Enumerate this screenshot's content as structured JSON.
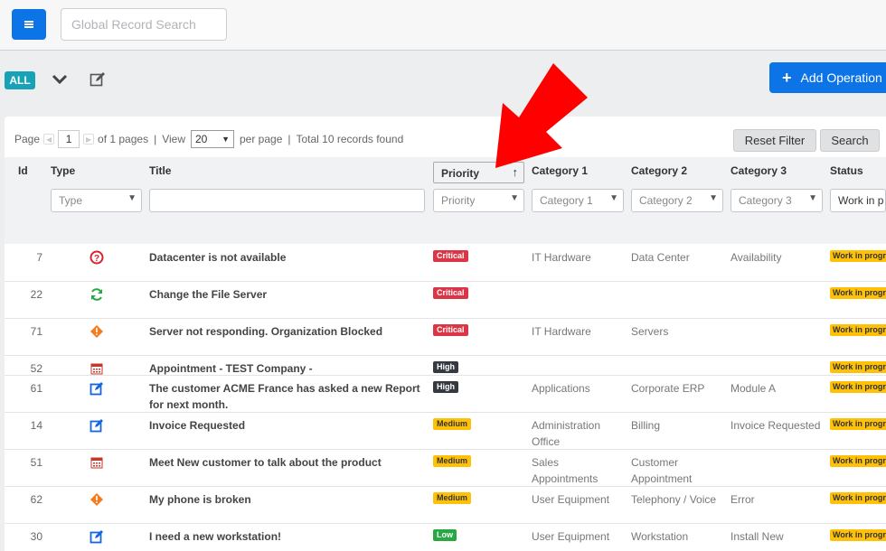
{
  "topbar": {
    "search_placeholder": "Global Record Search"
  },
  "toolbar": {
    "all_label": "ALL",
    "add_operation_label": "Add Operation"
  },
  "pager": {
    "page_label": "Page",
    "page_value": "1",
    "of_pages": "of 1 pages",
    "sep1": "|",
    "view_label": "View",
    "per_page_value": "20",
    "per_page_label": "per page",
    "sep2": "|",
    "total": "Total 10 records found"
  },
  "buttons": {
    "reset_filter": "Reset Filter",
    "search": "Search"
  },
  "columns": {
    "id": "Id",
    "type": "Type",
    "title": "Title",
    "priority": "Priority",
    "category1": "Category 1",
    "category2": "Category 2",
    "category3": "Category 3",
    "status": "Status"
  },
  "filters": {
    "type": "Type",
    "title": "",
    "priority": "Priority",
    "category1": "Category 1",
    "category2": "Category 2",
    "category3": "Category 3",
    "status": "Work in p"
  },
  "rows": [
    {
      "id": "7",
      "type_icon": "question-icon",
      "title": "Datacenter is not available",
      "priority": "Critical",
      "cat1": "IT Hardware",
      "cat2": "Data Center",
      "cat3": "Availability",
      "status": "Work in progress"
    },
    {
      "id": "22",
      "type_icon": "refresh-icon",
      "title": "Change the File Server",
      "priority": "Critical",
      "cat1": "",
      "cat2": "",
      "cat3": "",
      "status": "Work in progress"
    },
    {
      "id": "71",
      "type_icon": "warning-diamond-icon",
      "title": "Server not responding. Organization Blocked",
      "priority": "Critical",
      "cat1": "IT Hardware",
      "cat2": "Servers",
      "cat3": "",
      "status": "Work in progress"
    },
    {
      "id": "52",
      "type_icon": "calendar-icon",
      "title": "Appointment - TEST Company -",
      "priority": "High",
      "cat1": "",
      "cat2": "",
      "cat3": "",
      "status": "Work in progress"
    },
    {
      "id": "61",
      "type_icon": "edit-icon",
      "title": "The customer ACME France has asked a new Report for next month.",
      "priority": "High",
      "cat1": "Applications",
      "cat2": "Corporate ERP",
      "cat3": "Module A",
      "status": "Work in progress"
    },
    {
      "id": "14",
      "type_icon": "edit-icon",
      "title": "Invoice Requested",
      "priority": "Medium",
      "cat1": "Administration Office",
      "cat2": "Billing",
      "cat3": "Invoice Requested",
      "status": "Work in progress"
    },
    {
      "id": "51",
      "type_icon": "calendar-icon",
      "title": "Meet New customer to talk about the product",
      "priority": "Medium",
      "cat1": "Sales Appointments",
      "cat2": "Customer Appointment",
      "cat3": "",
      "status": "Work in progress"
    },
    {
      "id": "62",
      "type_icon": "warning-diamond-icon",
      "title": "My phone is broken",
      "priority": "Medium",
      "cat1": "User Equipment",
      "cat2": "Telephony / Voice",
      "cat3": "Error",
      "status": "Work in progress"
    },
    {
      "id": "30",
      "type_icon": "edit-icon",
      "title": "I need a new workstation!",
      "priority": "Low",
      "cat1": "User Equipment",
      "cat2": "Workstation",
      "cat3": "Install New",
      "status": "Work in progress"
    }
  ],
  "colors": {
    "accent": "#0d74e8",
    "critical": "#dc3545",
    "high": "#343a40",
    "medium": "#ffc107",
    "low": "#28a745",
    "annotation_arrow": "#ff0000"
  }
}
